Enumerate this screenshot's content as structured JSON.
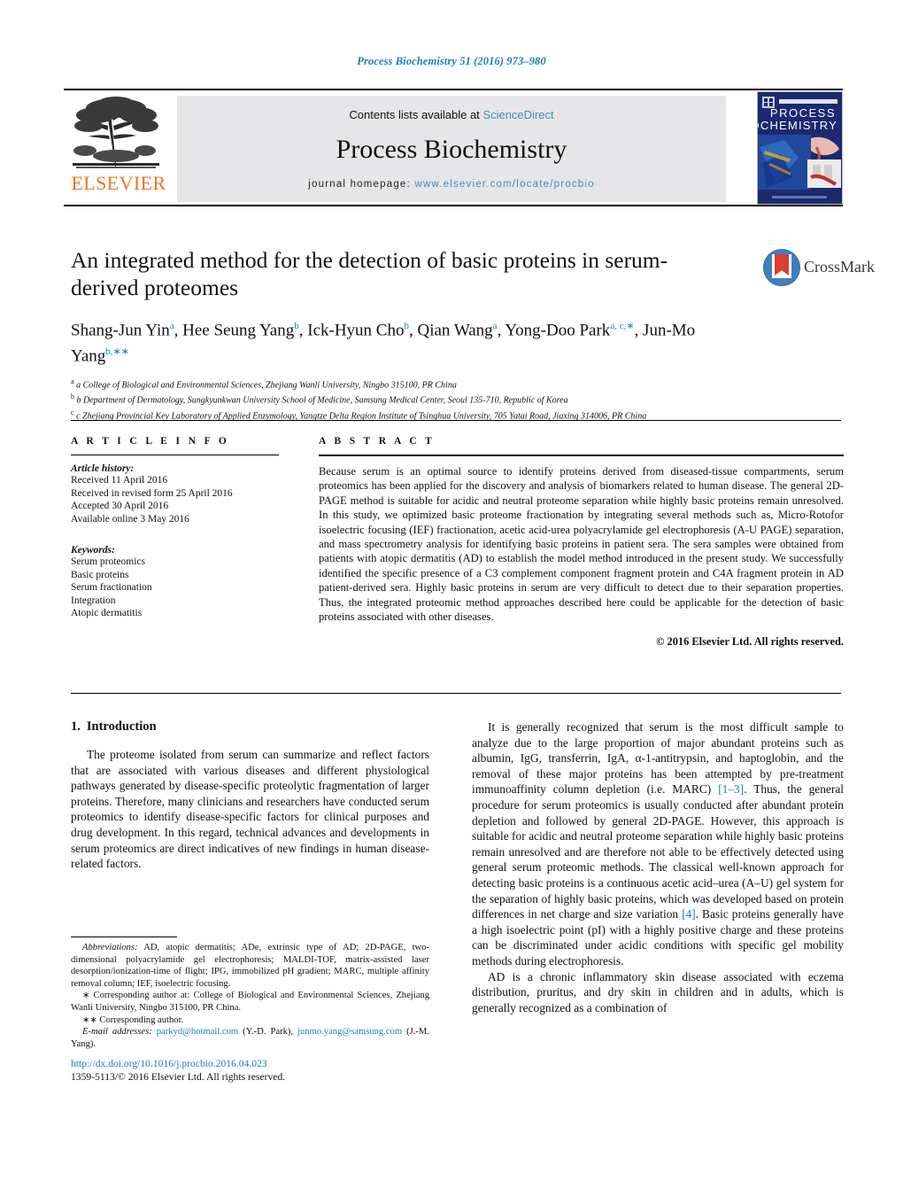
{
  "running_head": "Process Biochemistry 51 (2016) 973–980",
  "masthead": {
    "contents_prefix": "Contents lists available at ",
    "sciencedirect": "ScienceDirect",
    "journal_title": "Process Biochemistry",
    "homepage_prefix": "journal homepage: ",
    "homepage_url": "www.elsevier.com/locate/procbio",
    "publisher": "ELSEVIER",
    "cover": {
      "line1": "PROCESS",
      "line2": "BIOCHEMISTRY"
    },
    "accent_link_color": "#3c8dbc",
    "publisher_color": "#E87722"
  },
  "crossmark": {
    "label": "CrossMark"
  },
  "title": "An integrated method for the detection of basic proteins in serum-derived proteomes",
  "authors_html": "Shang-Jun Yin<sup>a</sup>, Hee Seung Yang<sup>b</sup>, Ick-Hyun Cho<sup>b</sup>, Qian Wang<sup>a</sup>, Yong-Doo Park<sup>a, c,∗</sup>, Jun-Mo Yang<sup>b,∗∗</sup>",
  "affiliations": [
    "a College of Biological and Environmental Sciences, Zhejiang Wanli University, Ningbo 315100, PR China",
    "b Department of Dermatology, Sungkyunkwan University School of Medicine, Samsung Medical Center, Seoul 135-710, Republic of Korea",
    "c Zhejiang Provincial Key Laboratory of Applied Enzymology, Yangtze Delta Region Institute of Tsinghua University, 705 Yatai Road, Jiaxing 314006, PR China"
  ],
  "article_info": {
    "heading": "A R T I C L E   I N F O",
    "history_label": "Article history:",
    "history": [
      "Received 11 April 2016",
      "Received in revised form 25 April 2016",
      "Accepted 30 April 2016",
      "Available online 3 May 2016"
    ],
    "keywords_label": "Keywords:",
    "keywords": [
      "Serum proteomics",
      "Basic proteins",
      "Serum fractionation",
      "Integration",
      "Atopic dermatitis"
    ]
  },
  "abstract": {
    "heading": "A B S T R A C T",
    "text": "Because serum is an optimal source to identify proteins derived from diseased-tissue compartments, serum proteomics has been applied for the discovery and analysis of biomarkers related to human disease. The general 2D-PAGE method is suitable for acidic and neutral proteome separation while highly basic proteins remain unresolved. In this study, we optimized basic proteome fractionation by integrating several methods such as, Micro-Rotofor isoelectric focusing (IEF) fractionation, acetic acid-urea polyacrylamide gel electrophoresis (A-U PAGE) separation, and mass spectrometry analysis for identifying basic proteins in patient sera. The sera samples were obtained from patients with atopic dermatitis (AD) to establish the model method introduced in the present study. We successfully identified the specific presence of a C3 complement component fragment protein and C4A fragment protein in AD patient-derived sera. Highly basic proteins in serum are very difficult to detect due to their separation properties. Thus, the integrated proteomic method approaches described here could be applicable for the detection of basic proteins associated with other diseases.",
    "copyright": "© 2016 Elsevier Ltd. All rights reserved."
  },
  "introduction": {
    "number": "1.",
    "heading": "Introduction",
    "left_paragraph": "The proteome isolated from serum can summarize and reflect factors that are associated with various diseases and different physiological pathways generated by disease-specific proteolytic fragmentation of larger proteins. Therefore, many clinicians and researchers have conducted serum proteomics to identify disease-specific factors for clinical purposes and drug development. In this regard, technical advances and developments in serum proteomics are direct indicatives of new findings in human disease-related factors.",
    "right_paragraph_1a": "It is generally recognized that serum is the most difficult sample to analyze due to the large proportion of major abundant proteins such as albumin, IgG, transferrin, IgA, α-1-antitrypsin, and haptoglobin, and the removal of these major proteins has been attempted by pre-treatment immunoaffinity column depletion (i.e. MARC) ",
    "cite_1": "[1–3]",
    "right_paragraph_1b": ". Thus, the general procedure for serum proteomics is usually conducted after abundant protein depletion and followed by general 2D-PAGE. However, this approach is suitable for acidic and neutral proteome separation while highly basic proteins remain unresolved and are therefore not able to be effectively detected using general serum proteomic methods. The classical well-known approach for detecting basic proteins is a continuous acetic acid–urea (A–U) gel system for the separation of highly basic proteins, which was developed based on protein differences in net charge and size variation ",
    "cite_2": "[4]",
    "right_paragraph_1c": ". Basic proteins generally have a high isoelectric point (pI) with a highly positive charge and these proteins can be discriminated under acidic conditions with specific gel mobility methods during electrophoresis.",
    "right_paragraph_2": "AD is a chronic inflammatory skin disease associated with eczema distribution, pruritus, and dry skin in children and in adults, which is generally recognized as a combination of"
  },
  "footnotes": {
    "abbreviations_label": "Abbreviations:",
    "abbreviations_text": " AD, atopic dermatitis; ADe, extrinsic type of AD; 2D-PAGE, two-dimensional polyacrylamide gel electrophoresis; MALDI-TOF, matrix-assisted laser desorption/ionization-time of flight; IPG, immobilized pH gradient; MARC, multiple affinity removal column; IEF, isoelectric focusing.",
    "corresponding_1_mark": "∗",
    "corresponding_1_text": " Corresponding author at: College of Biological and Environmental Sciences, Zhejiang Wanli University, Ningbo 315100, PR China.",
    "corresponding_2_mark": "∗∗",
    "corresponding_2_text": " Corresponding author.",
    "email_label": "E-mail addresses:",
    "email_1": "parkyd@hotmail.com",
    "email_1_owner": " (Y.-D. Park), ",
    "email_2": "junmo.yang@samsung.com",
    "email_2_owner": " (J.-M. Yang)."
  },
  "doi": {
    "url": "http://dx.doi.org/10.1016/j.procbio.2016.04.023",
    "issn": "1359-5113/© 2016 Elsevier Ltd. All rights reserved."
  }
}
